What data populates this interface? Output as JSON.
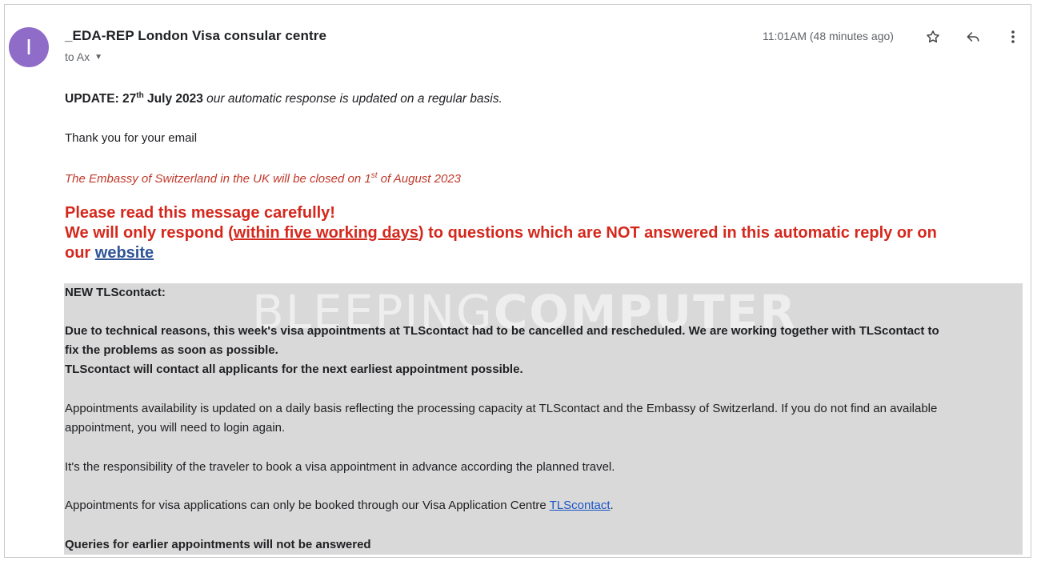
{
  "header": {
    "avatar_letter": "I",
    "sender": "_EDA-REP London Visa consular centre",
    "to_label": "to Ax",
    "time": "11:01AM (48 minutes ago)",
    "icons": [
      "star-icon",
      "reply-icon",
      "more-vert-icon",
      "chevron-down-icon"
    ]
  },
  "body": {
    "update_prefix": "UPDATE: 27",
    "update_sup": "th",
    "update_rest": " July 2023",
    "update_italic": " our automatic response is updated on a regular basis.",
    "thanks": "Thank you for your email",
    "closure_prefix": "The Embassy of Switzerland in the UK will be closed on 1",
    "closure_sup": "st",
    "closure_rest": " of August 2023",
    "warn_line1": "Please read this message carefully!",
    "warn_line2_a": "We will only respond (",
    "warn_line2_u": "within five working days",
    "warn_line2_b": ") to questions which are NOT answered in this automatic reply or on",
    "warn_line3_a": "our ",
    "warn_link": "website"
  },
  "notice": {
    "watermark_thin": "BLEEPING",
    "watermark_bold": "COMPUTER",
    "heading": "NEW TLScontact:",
    "red_p1_l1": "Due to technical reasons, this week's visa appointments at TLScontact had to be cancelled and rescheduled. We are working together with TLScontact to",
    "red_p1_l2": "fix the problems as soon as possible.",
    "red_p2": "TLScontact will contact all applicants for the next earliest appointment possible.",
    "p_avail_l1": "Appointments availability is updated on a daily basis reflecting the processing capacity at TLScontact and the Embassy of Switzerland. If you do not find an available",
    "p_avail_l2": "appointment, you will need to login again.",
    "p_resp": "It's the responsibility of the traveler to book a visa appointment in advance according the planned travel.",
    "p_book_a": "Appointments for visa applications can only be booked through our Visa Application Centre ",
    "p_book_link": "TLScontact",
    "p_book_b": ".",
    "p_queries": "Queries for earlier appointments will not be answered"
  },
  "colors": {
    "avatar": "#8e6cc8",
    "warning_red": "#d5281d",
    "italic_red": "#c0392b",
    "link_blue": "#1a55c7",
    "notice_grey": "#d9d9d9"
  }
}
